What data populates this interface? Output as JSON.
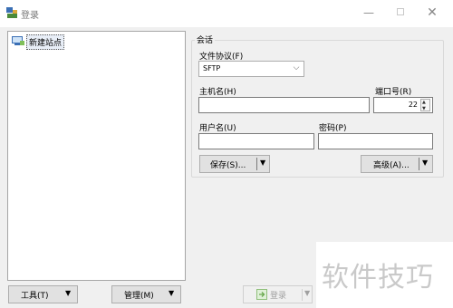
{
  "window": {
    "title": "登录",
    "minimize": "—",
    "close": "✕"
  },
  "site_tree": {
    "items": [
      {
        "label": "新建站点"
      }
    ]
  },
  "session": {
    "group_title": "会话",
    "protocol": {
      "label": "文件协议(F)",
      "value": "SFTP"
    },
    "host": {
      "label": "主机名(H)",
      "value": ""
    },
    "port": {
      "label": "端口号(R)",
      "value": "22"
    },
    "user": {
      "label": "用户名(U)",
      "value": ""
    },
    "password": {
      "label": "密码(P)",
      "value": ""
    },
    "save_label": "保存(S)...",
    "advanced_label": "高级(A)..."
  },
  "footer": {
    "tools_label": "工具(T)",
    "manage_label": "管理(M)",
    "login_label": "登录"
  },
  "watermark": {
    "text": "软件技巧"
  }
}
